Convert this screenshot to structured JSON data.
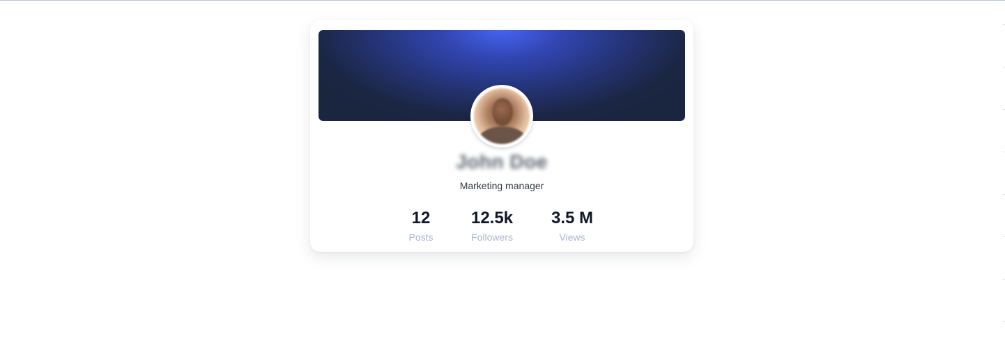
{
  "profile": {
    "name": "John Doe",
    "role": "Marketing manager",
    "avatar_icon": "user-photo-avatar"
  },
  "stats": [
    {
      "value": "12",
      "label": "Posts"
    },
    {
      "value": "12.5k",
      "label": "Followers"
    },
    {
      "value": "3.5 M",
      "label": "Views"
    }
  ],
  "colors": {
    "banner_highlight": "#4563f0",
    "banner_dark": "#1a2540",
    "stat_value": "#111827",
    "stat_label": "#a8b6cc"
  }
}
